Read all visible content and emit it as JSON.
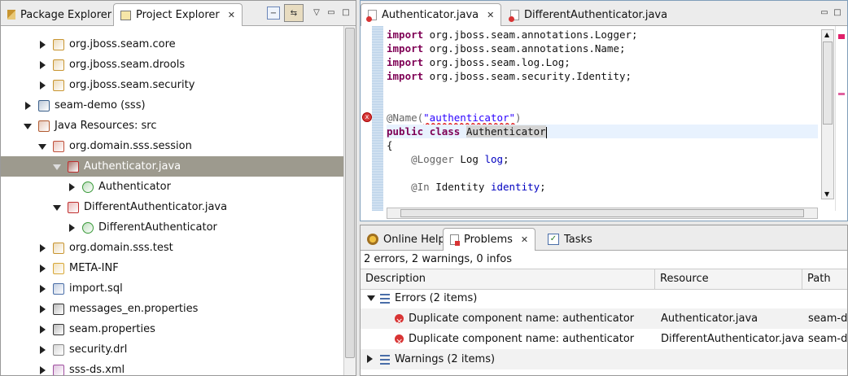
{
  "left_panel": {
    "tabs": [
      {
        "label": "Package Explorer"
      },
      {
        "label": "Project Explorer"
      }
    ],
    "tree": [
      {
        "label": "org.jboss.seam.core",
        "indent": 2,
        "arrow": "c",
        "icon": "package-icon",
        "color": "#c89530"
      },
      {
        "label": "org.jboss.seam.drools",
        "indent": 2,
        "arrow": "c",
        "icon": "package-icon",
        "color": "#c89530"
      },
      {
        "label": "org.jboss.seam.security",
        "indent": 2,
        "arrow": "c",
        "icon": "package-icon",
        "color": "#c89530"
      },
      {
        "label": "seam-demo (sss)",
        "indent": 1,
        "arrow": "c",
        "icon": "project-icon",
        "color": "#3a5f8a"
      },
      {
        "label": "Java Resources: src",
        "indent": 1,
        "arrow": "e",
        "icon": "source-folder-icon",
        "color": "#b05a30"
      },
      {
        "label": "org.domain.sss.session",
        "indent": 2,
        "arrow": "e",
        "icon": "package-error-icon",
        "color": "#c0503a"
      },
      {
        "label": "Authenticator.java",
        "indent": 3,
        "arrow": "e",
        "icon": "java-file-error-icon",
        "color": "#c03030",
        "selected": true
      },
      {
        "label": "Authenticator",
        "indent": 4,
        "arrow": "c",
        "icon": "class-icon",
        "color": "#3a9a3a"
      },
      {
        "label": "DifferentAuthenticator.java",
        "indent": 3,
        "arrow": "e",
        "icon": "java-file-error-icon",
        "color": "#c03030"
      },
      {
        "label": "DifferentAuthenticator",
        "indent": 4,
        "arrow": "c",
        "icon": "class-icon",
        "color": "#3a9a3a"
      },
      {
        "label": "org.domain.sss.test",
        "indent": 2,
        "arrow": "c",
        "icon": "package-icon",
        "color": "#c89530"
      },
      {
        "label": "META-INF",
        "indent": 2,
        "arrow": "c",
        "icon": "folder-icon",
        "color": "#d8a838"
      },
      {
        "label": "import.sql",
        "indent": 2,
        "arrow": "c",
        "icon": "sql-file-icon",
        "color": "#4a6ea8"
      },
      {
        "label": "messages_en.properties",
        "indent": 2,
        "arrow": "c",
        "icon": "properties-file-icon",
        "color": "#333333"
      },
      {
        "label": "seam.properties",
        "indent": 2,
        "arrow": "c",
        "icon": "properties-file-icon",
        "color": "#333333"
      },
      {
        "label": "security.drl",
        "indent": 2,
        "arrow": "c",
        "icon": "text-file-icon",
        "color": "#888888"
      },
      {
        "label": "sss-ds.xml",
        "indent": 2,
        "arrow": "c",
        "icon": "xml-file-icon",
        "color": "#a050a0"
      }
    ]
  },
  "editor": {
    "tabs": [
      {
        "label": "Authenticator.java"
      },
      {
        "label": "DifferentAuthenticator.java"
      }
    ],
    "lines": {
      "l1_kw": "import",
      "l1_rest": " org.jboss.seam.annotations.Logger;",
      "l2_kw": "import",
      "l2_rest": " org.jboss.seam.annotations.Name;",
      "l3_kw": "import",
      "l3_rest": " org.jboss.seam.log.Log;",
      "l4_kw": "import",
      "l4_rest": " org.jboss.seam.security.Identity;",
      "l7_ann": "@Name(",
      "l7_str": "\"authenticator\"",
      "l7_end": ")",
      "l8_kw1": "public",
      "l8_kw2": "class",
      "l8_name": "Authenticator",
      "l9": "{",
      "l10_ann": "@Logger",
      "l10_type": " Log ",
      "l10_fld": "log",
      "l10_end": ";",
      "l12_ann": "@In",
      "l12_type": " Identity ",
      "l12_fld": "identity",
      "l12_end": ";"
    }
  },
  "bottom_panel": {
    "tabs": [
      {
        "label": "Online Help"
      },
      {
        "label": "Problems"
      },
      {
        "label": "Tasks"
      }
    ],
    "status": "2 errors, 2 warnings, 0 infos",
    "columns": [
      "Description",
      "Resource",
      "Path"
    ],
    "errors_group": "Errors (2 items)",
    "warnings_group": "Warnings (2 items)",
    "rows": [
      {
        "description": "Duplicate component name: authenticator",
        "resource": "Authenticator.java",
        "path": "seam-d"
      },
      {
        "description": "Duplicate component name: authenticator",
        "resource": "DifferentAuthenticator.java",
        "path": "seam-d"
      }
    ]
  }
}
